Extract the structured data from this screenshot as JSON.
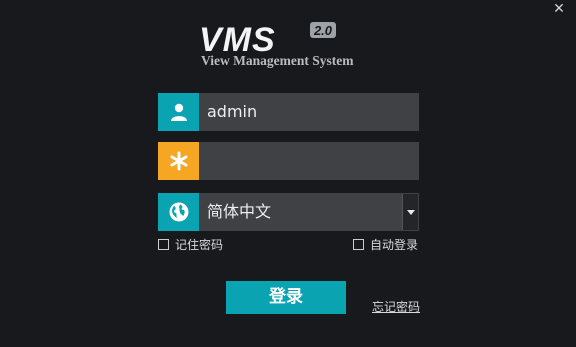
{
  "window": {
    "close_glyph": "✕"
  },
  "logo": {
    "title": "VMS",
    "version": "2.0",
    "subtitle": "View Management System"
  },
  "form": {
    "username": {
      "value": "admin",
      "icon": "user-icon"
    },
    "password": {
      "value": "",
      "icon": "asterisk-icon"
    },
    "language": {
      "value": "简体中文",
      "icon": "globe-icon"
    }
  },
  "options": {
    "remember_password": {
      "label": "记住密码",
      "checked": false
    },
    "auto_login": {
      "label": "自动登录",
      "checked": false
    }
  },
  "actions": {
    "login_label": "登录",
    "forgot_label": "忘记密码"
  },
  "colors": {
    "background": "#17191c",
    "accent": "#0aa3b1",
    "password_icon_bg": "#f5a623",
    "field_bg": "#3f4145"
  }
}
